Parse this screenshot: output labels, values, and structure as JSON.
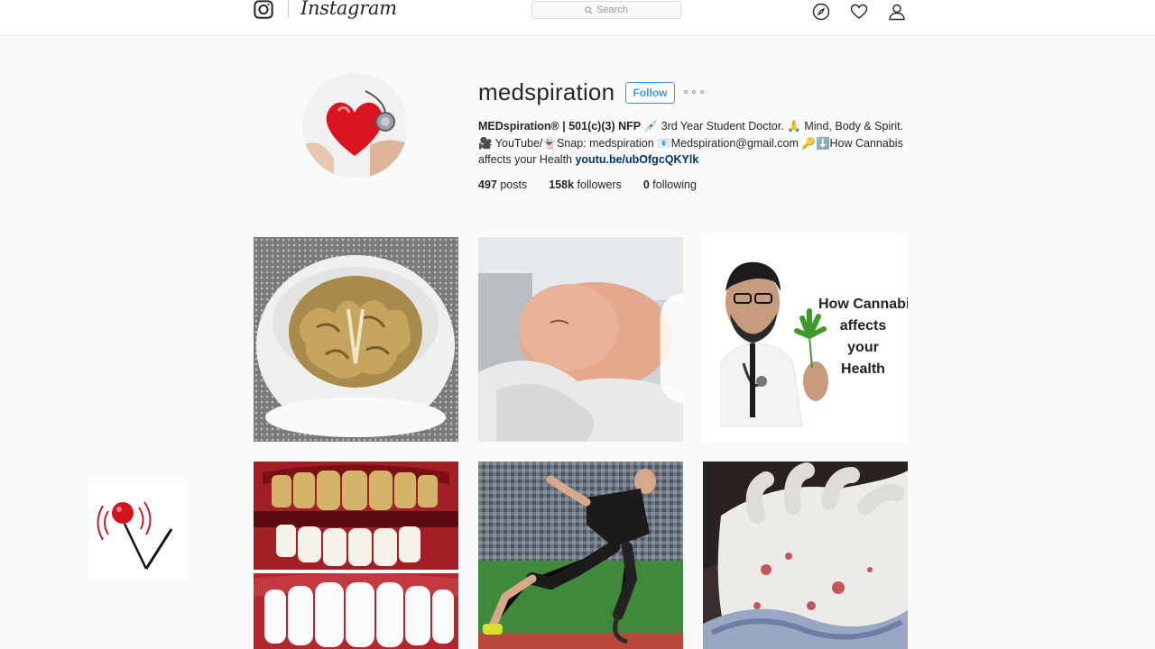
{
  "nav": {
    "wordmark": "Instagram",
    "search_placeholder": "Search"
  },
  "profile": {
    "username": "medspiration",
    "follow_label": "Follow",
    "bio": {
      "name": "MEDspiration® | 501(c)(3) NFP",
      "line1_rest": " 💉 3rd Year Student Doctor. 🙏 Mind, Body & Spirit.",
      "line2": "🎥 YouTube/👻Snap: medspiration 📧Medspiration@gmail.com 🔑⬇️How Cannabis affects your Health ",
      "link": "youtu.be/ubOfgcQKYlk"
    },
    "stats": {
      "posts_count": "497",
      "posts_label": "posts",
      "followers_count": "158k",
      "followers_label": "followers",
      "following_count": "0",
      "following_label": "following"
    }
  },
  "posts": [
    {
      "subject": "brain in bucket"
    },
    {
      "subject": "newborn baby",
      "video": true
    },
    {
      "subject": "doctor holding cannabis leaf",
      "overlay_text": "How Cannabis affects your Health"
    },
    {
      "subject": "teeth before and after"
    },
    {
      "subject": "sprinter with prosthetic leg"
    },
    {
      "subject": "gloved hand with specimen"
    }
  ],
  "colors": {
    "accent": "#3897f0",
    "link": "#003569",
    "background": "#fafafa"
  }
}
